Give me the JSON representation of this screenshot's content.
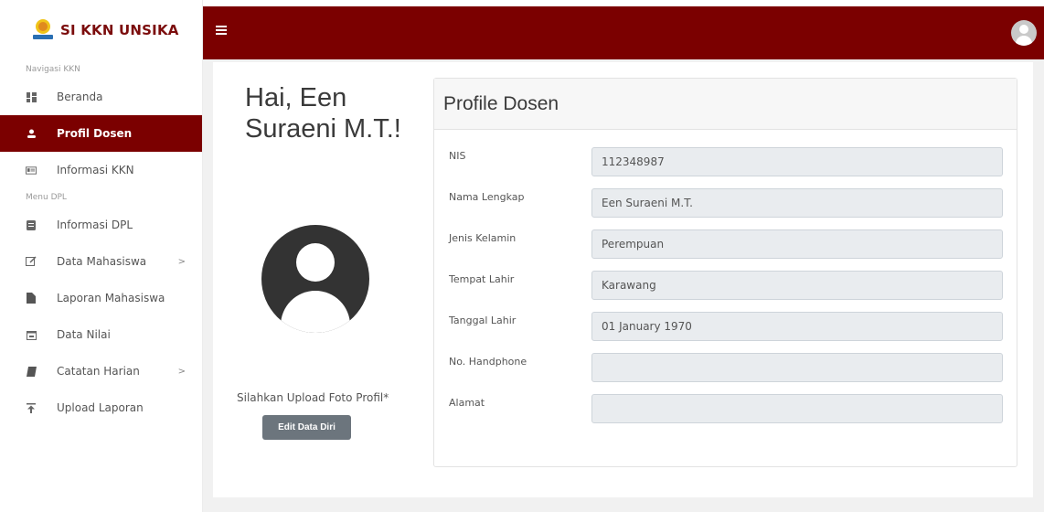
{
  "brand": {
    "name": "SI KKN UNSIKA"
  },
  "sidebar": {
    "section1": "Navigasi KKN",
    "section2": "Menu DPL",
    "items": [
      {
        "label": "Beranda",
        "icon": "dashboard-icon"
      },
      {
        "label": "Profil Dosen",
        "icon": "user-icon",
        "active": true
      },
      {
        "label": "Informasi KKN",
        "icon": "id-card-icon"
      },
      {
        "label": "Informasi DPL",
        "icon": "book-icon"
      },
      {
        "label": "Data Mahasiswa",
        "icon": "edit-icon",
        "chevron": ">"
      },
      {
        "label": "Laporan Mahasiswa",
        "icon": "file-icon"
      },
      {
        "label": "Data Nilai",
        "icon": "calendar-icon"
      },
      {
        "label": "Catatan Harian",
        "icon": "notebook-icon",
        "chevron": ">"
      },
      {
        "label": "Upload Laporan",
        "icon": "upload-icon"
      }
    ]
  },
  "topbar": {
    "menu_icon": "hamburger-icon",
    "avatar_icon": "user-avatar-icon"
  },
  "main": {
    "greeting": "Hai, Een Suraeni M.T.!",
    "upload_hint": "Silahkan Upload Foto Profil*",
    "edit_button": "Edit Data Diri"
  },
  "profile": {
    "title": "Profile Dosen",
    "fields": [
      {
        "label": "NIS",
        "value": "112348987"
      },
      {
        "label": "Nama Lengkap",
        "value": "Een Suraeni M.T."
      },
      {
        "label": "Jenis Kelamin",
        "value": "Perempuan"
      },
      {
        "label": "Tempat Lahir",
        "value": "Karawang"
      },
      {
        "label": "Tanggal Lahir",
        "value": "01 January 1970"
      },
      {
        "label": "No. Handphone",
        "value": ""
      },
      {
        "label": "Alamat",
        "value": ""
      }
    ]
  },
  "colors": {
    "primary": "#7b0000",
    "brand_text": "#7b0c0c",
    "button": "#6c757d"
  }
}
